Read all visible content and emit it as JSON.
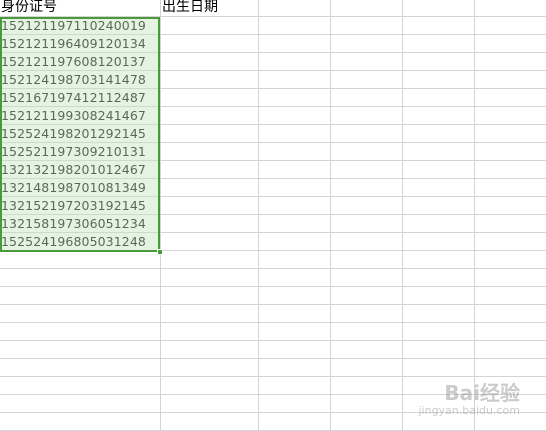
{
  "columns": {
    "a_header": "身份证号",
    "b_header": "出生日期"
  },
  "ids": [
    "152121197110240019",
    "152121196409120134",
    "152121197608120137",
    "152124198703141478",
    "152167197412112487",
    "152121199308241467",
    "152524198201292145",
    "152521197309210131",
    "132132198201012467",
    "132148198701081349",
    "132152197203192145",
    "132158197306051234",
    "152524196805031248"
  ],
  "watermark": {
    "brand": "Bai经验",
    "url": "jingyan.baidu.com"
  },
  "colors": {
    "selection_border": "#4a9a3c",
    "selection_fill": "#c6e6be",
    "gridline": "#d4d4d4"
  }
}
